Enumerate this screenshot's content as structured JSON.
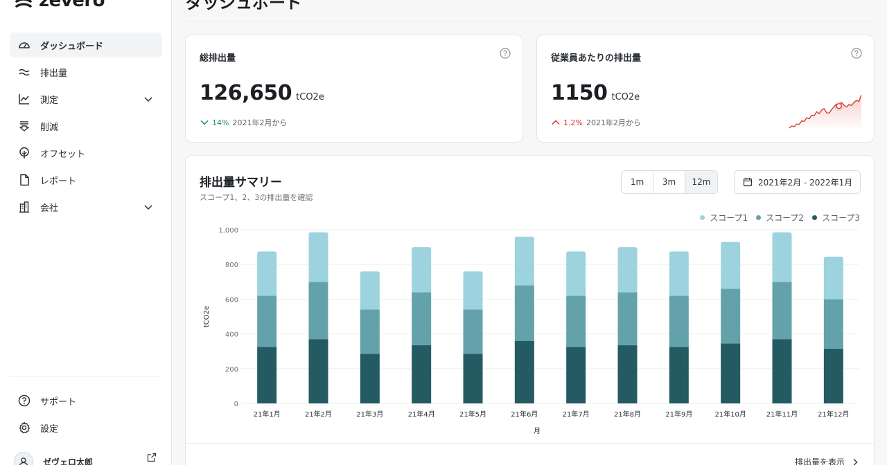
{
  "brand": {
    "name": "zevero"
  },
  "page": {
    "title": "ダッシュボード"
  },
  "sidebar": {
    "items": [
      {
        "label": "ダッシュボード",
        "icon": "gauge-icon",
        "active": true
      },
      {
        "label": "排出量",
        "icon": "wave-icon"
      },
      {
        "label": "測定",
        "icon": "line-chart-icon",
        "expandable": true
      },
      {
        "label": "削減",
        "icon": "reduce-icon"
      },
      {
        "label": "オフセット",
        "icon": "tree-icon"
      },
      {
        "label": "レポート",
        "icon": "document-icon"
      },
      {
        "label": "会社",
        "icon": "building-icon",
        "expandable": true
      }
    ],
    "bottom_items": [
      {
        "label": "サポート",
        "icon": "help-circle-icon"
      },
      {
        "label": "設定",
        "icon": "gear-icon"
      }
    ],
    "user": {
      "name": "ゼヴェロ太郎"
    }
  },
  "cards": {
    "total": {
      "title": "総排出量",
      "value": "126,650",
      "unit": "tCO2e",
      "change_pct": "14%",
      "change_dir": "down",
      "change_text": "2021年2月から"
    },
    "per_employee": {
      "title": "従業員あたりの排出量",
      "value": "1150",
      "unit": "tCO2e",
      "change_pct": "1.2%",
      "change_dir": "up",
      "change_text": "2021年2月から"
    }
  },
  "summary": {
    "title": "排出量サマリー",
    "subtitle": "スコープ1、2、3の排出量を確認",
    "ranges": [
      "1m",
      "3m",
      "12m"
    ],
    "active_range": "12m",
    "date_range": "2021年2月 - 2022年1月",
    "footer_link": "排出量を表示"
  },
  "colors": {
    "scope1": "#9dd3df",
    "scope2": "#63a2ab",
    "scope3": "#245a62",
    "accent_red": "#d93025",
    "accent_green": "#1f8a4c"
  },
  "chart_data": {
    "type": "bar",
    "stacked": true,
    "categories": [
      "21年1月",
      "21年2月",
      "21年3月",
      "21年4月",
      "21年5月",
      "21年6月",
      "21年7月",
      "21年8月",
      "21年9月",
      "21年10月",
      "21年11月",
      "21年12月"
    ],
    "series": [
      {
        "name": "スコープ3",
        "values": [
          325,
          370,
          285,
          335,
          285,
          360,
          325,
          335,
          325,
          345,
          370,
          315
        ]
      },
      {
        "name": "スコープ2",
        "values": [
          295,
          330,
          255,
          305,
          255,
          320,
          295,
          305,
          295,
          315,
          330,
          285
        ]
      },
      {
        "name": "スコープ1",
        "values": [
          255,
          285,
          220,
          260,
          220,
          280,
          255,
          260,
          255,
          270,
          285,
          245
        ]
      }
    ],
    "xlabel": "月",
    "ylabel": "tCO2e",
    "ylim": [
      0,
      1000
    ],
    "yticks": [
      "0",
      "200",
      "400",
      "600",
      "800",
      "1,000"
    ],
    "legend": [
      "スコープ1",
      "スコープ2",
      "スコープ3"
    ],
    "legend_position": "top-right",
    "grid": true
  },
  "sparkline_data": {
    "type": "line",
    "values": [
      20,
      24,
      23,
      28,
      27,
      34,
      33,
      40,
      38,
      45,
      44,
      52,
      48,
      55,
      58,
      50,
      49,
      56,
      62,
      66,
      63,
      70,
      65,
      61,
      66,
      64,
      70,
      74,
      72,
      85
    ]
  }
}
